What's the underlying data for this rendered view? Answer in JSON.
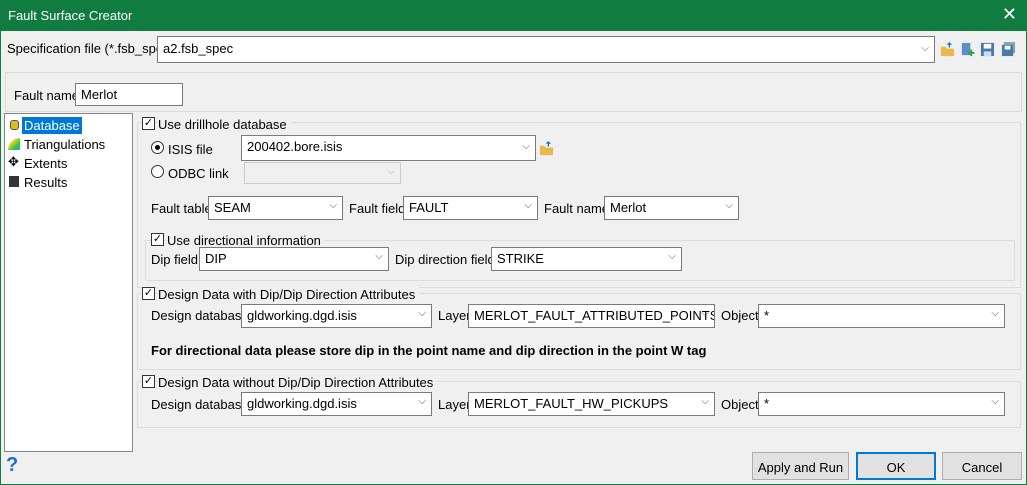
{
  "window": {
    "title": "Fault Surface Creator",
    "close": "✕"
  },
  "spec": {
    "label": "Specification file (*.fsb_spec)",
    "value": "a2.fsb_spec"
  },
  "fault_name": {
    "label": "Fault name",
    "value": "Merlot"
  },
  "tree": [
    {
      "label": "Database",
      "selected": true
    },
    {
      "label": "Triangulations"
    },
    {
      "label": "Extents"
    },
    {
      "label": "Results"
    }
  ],
  "drillhole": {
    "label": "Use drillhole database",
    "checked": true,
    "isis_label": "ISIS file",
    "isis_value": "200402.bore.isis",
    "odbc_label": "ODBC link",
    "odbc_value": "",
    "fault_table_label": "Fault table",
    "fault_table": "SEAM",
    "fault_field_label": "Fault field",
    "fault_field": "FAULT",
    "fault_name_label": "Fault name",
    "fault_name": "Merlot",
    "directional_label": "Use directional information",
    "dip_field_label": "Dip field",
    "dip_field": "DIP",
    "dipdir_label": "Dip direction field",
    "dipdir": "STRIKE"
  },
  "design_with": {
    "label": "Design Data with Dip/Dip Direction Attributes",
    "db_label": "Design database",
    "db": "gldworking.dgd.isis",
    "layer_label": "Layer",
    "layer": "MERLOT_FAULT_ATTRIBUTED_POINTS_UPD.",
    "object_label": "Object",
    "object": "*",
    "note": "For directional data please store dip in the point name and dip direction in the point W tag"
  },
  "design_without": {
    "label": "Design Data without Dip/Dip Direction Attributes",
    "db_label": "Design database",
    "db": "gldworking.dgd.isis",
    "layer_label": "Layer",
    "layer": "MERLOT_FAULT_HW_PICKUPS",
    "object_label": "Object",
    "object": "*"
  },
  "buttons": {
    "help": "?",
    "apply": "Apply and Run",
    "ok": "OK",
    "cancel": "Cancel"
  },
  "colors": {
    "title_bar": "#107c3f",
    "selection": "#0078d7"
  }
}
